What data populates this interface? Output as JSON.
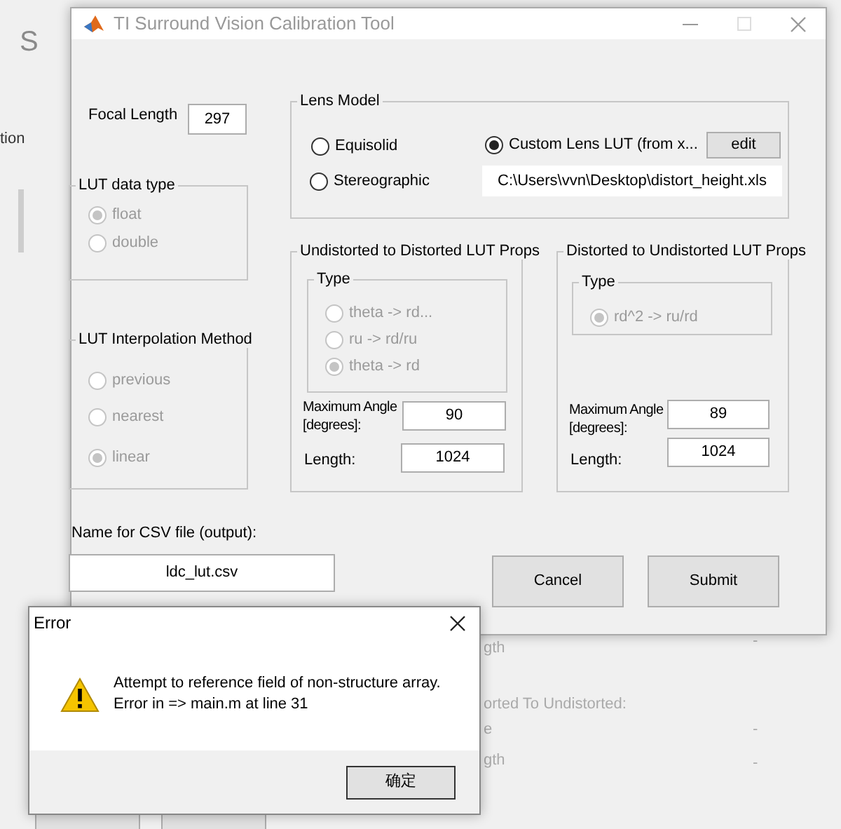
{
  "background_window": {
    "texts": [
      "S",
      "tion",
      "gth",
      "orted To Undistorted:",
      "e",
      "gth"
    ],
    "dashes": [
      "-",
      "-",
      "-"
    ]
  },
  "window": {
    "title": "TI Surround Vision Calibration Tool",
    "maximize_disabled": true
  },
  "focal_length": {
    "label": "Focal Length",
    "value": "297"
  },
  "lens_model": {
    "title": "Lens Model",
    "options": [
      {
        "label": "Equisolid",
        "selected": false
      },
      {
        "label": "Stereographic",
        "selected": false
      },
      {
        "label": "Custom Lens LUT (from x...",
        "selected": true
      }
    ],
    "edit_button": "edit",
    "path": "C:\\Users\\vvn\\Desktop\\distort_height.xls"
  },
  "lut_data_type": {
    "title": "LUT data type",
    "disabled": true,
    "options": [
      {
        "label": "float",
        "selected": true
      },
      {
        "label": "double",
        "selected": false
      }
    ]
  },
  "undistorted_to_distorted": {
    "title": "Undistorted to Distorted LUT Props",
    "type_title": "Type",
    "disabled": true,
    "options": [
      {
        "label": "theta -> rd...",
        "selected": false
      },
      {
        "label": "ru -> rd/ru",
        "selected": false
      },
      {
        "label": "theta -> rd",
        "selected": true
      }
    ],
    "max_angle_label": "Maximum Angle [degrees]:",
    "max_angle": "90",
    "length_label": "Length:",
    "length": "1024"
  },
  "distorted_to_undistorted": {
    "title": "Distorted to Undistorted LUT Props",
    "type_title": "Type",
    "disabled": true,
    "options": [
      {
        "label": "rd^2 -> ru/rd",
        "selected": true
      }
    ],
    "max_angle_label": "Maximum Angle [degrees]:",
    "max_angle": "89",
    "length_label": "Length:",
    "length": "1024"
  },
  "interpolation": {
    "title": "LUT Interpolation Method",
    "disabled": true,
    "options": [
      {
        "label": "previous",
        "selected": false
      },
      {
        "label": "nearest",
        "selected": false
      },
      {
        "label": "linear",
        "selected": true
      }
    ]
  },
  "csv": {
    "label": "Name for CSV file (output):",
    "value": "ldc_lut.csv"
  },
  "buttons": [
    "Cancel",
    "Submit"
  ],
  "error_dialog": {
    "title": "Error",
    "message": [
      "Attempt to reference field of non-structure array.",
      "Error in => main.m at line 31"
    ],
    "button": "确定"
  }
}
